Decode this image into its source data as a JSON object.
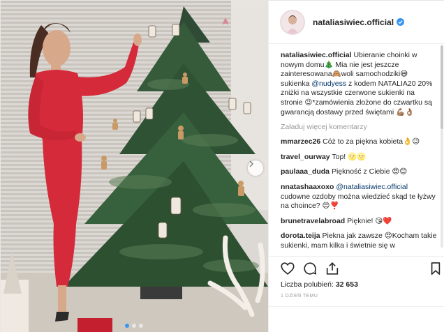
{
  "post": {
    "username": "nataliasiwiec.official",
    "caption": {
      "user": "nataliasiwiec.official",
      "p1": " Ubieranie choinki w nowym domu🎄 Mia nie jest jeszcze zainteresowana🙈woli samochodziki😅 sukienka ",
      "m1": "@nudyess",
      "p2": " z kodem NATALIA20 20% zniżki na wszystkie czerwone sukienki na stronie 😉*zamówienia złożone do czwartku są gwarancją dostawy przed świętami 💪🏽👌🏽"
    },
    "load_more": "Załaduj więcej komentarzy",
    "comments": [
      {
        "user": "mmarzec26",
        "text": " Cóż to za piękna kobieta👌😉"
      },
      {
        "user": "travel_ourway",
        "text": " Top! 🌝🌝"
      },
      {
        "user": "paulaaa_duda",
        "text": " Piękność z Ciebie 😍😊"
      },
      {
        "user": "nnatashaaxoxo",
        "mention": "@nataliasiwiec.official",
        "text": " cudowne ozdoby można wiedzieć skąd te łyżwy na choince? 😍❣️"
      },
      {
        "user": "brunetravelabroad",
        "text": " Pięknie! 😘❤️"
      },
      {
        "user": "dorota.teija",
        "text": " Piekna jak zawsze 😍Kocham takie sukienki, mam kilka i świetnie się w"
      }
    ],
    "likes_label": "Liczba polubień: ",
    "likes_count": "32 653",
    "time": "1 DZIEŃ TEMU"
  },
  "icons": {
    "like": "heart-icon",
    "comment": "comment-icon",
    "share": "share-icon",
    "save": "bookmark-icon",
    "next": "chevron-right-icon",
    "verified": "verified-badge-icon"
  },
  "colors": {
    "link": "#003569",
    "verified": "#3897f0",
    "muted": "#999999",
    "dress": "#d42a3a"
  }
}
